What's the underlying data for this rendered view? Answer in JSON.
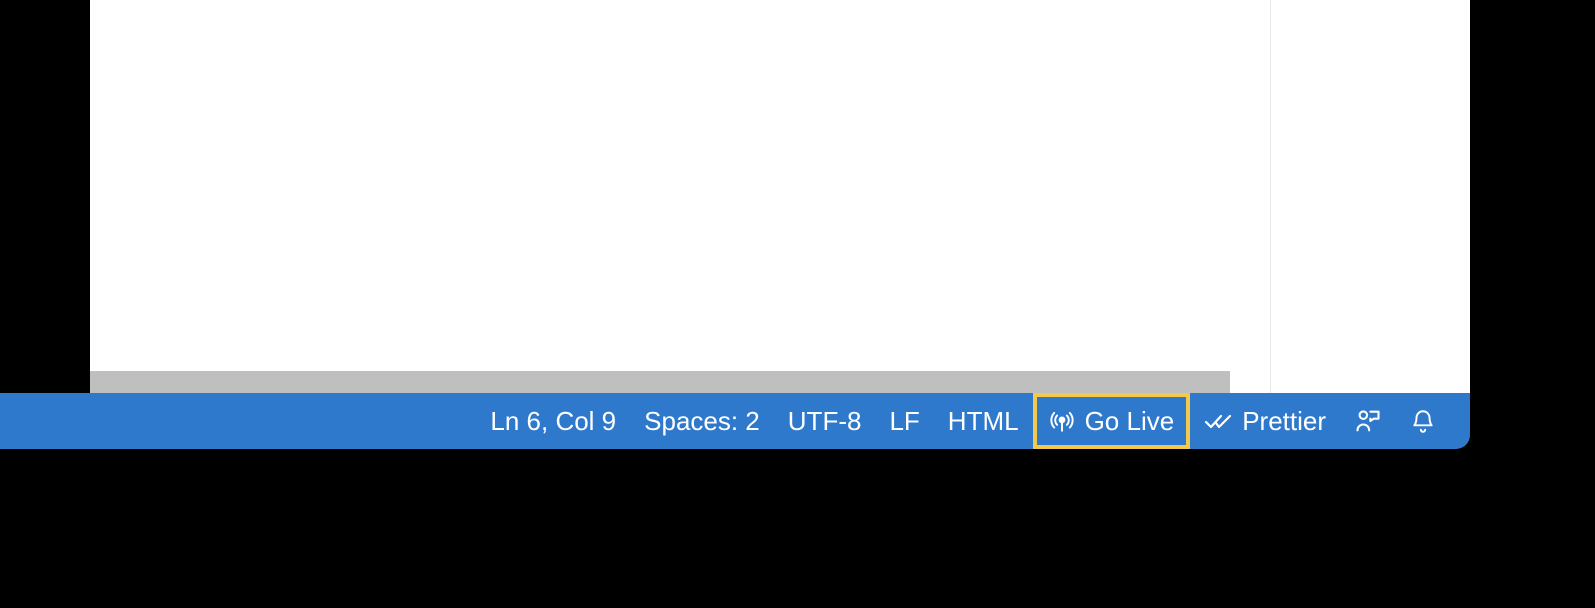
{
  "statusbar": {
    "cursor_position": "Ln 6, Col 9",
    "indentation": "Spaces: 2",
    "encoding": "UTF-8",
    "eol": "LF",
    "language": "HTML",
    "go_live": "Go Live",
    "prettier": "Prettier"
  }
}
